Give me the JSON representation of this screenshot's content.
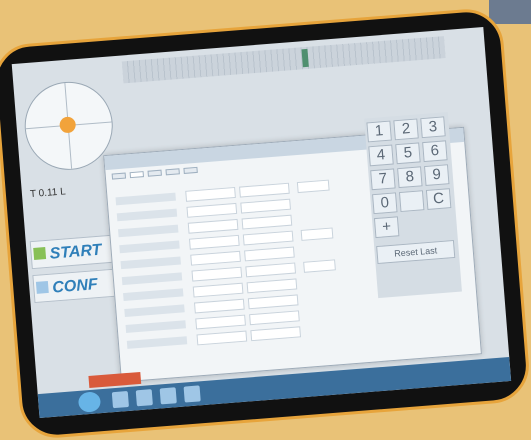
{
  "window": {
    "title": ""
  },
  "readout": {
    "label": "T 0.11 L",
    "t": "0.11"
  },
  "sidebar": {
    "start_label": "START",
    "conf_label": "CONF"
  },
  "dialog": {
    "tabs": [
      "",
      "",
      "",
      "",
      ""
    ],
    "active_tab": 1
  },
  "keypad": {
    "keys": [
      "1",
      "2",
      "3",
      "4",
      "5",
      "6",
      "7",
      "8",
      "9",
      "0",
      "",
      "C",
      "+"
    ],
    "reset_label": "Reset Last"
  },
  "taskbar": {
    "icons": [
      "start-orb",
      "explorer",
      "browser",
      "media",
      "app"
    ]
  },
  "colors": {
    "accent": "#2f7fb9",
    "orange_frame": "#e7a43b",
    "warning": "#d95a3b"
  }
}
